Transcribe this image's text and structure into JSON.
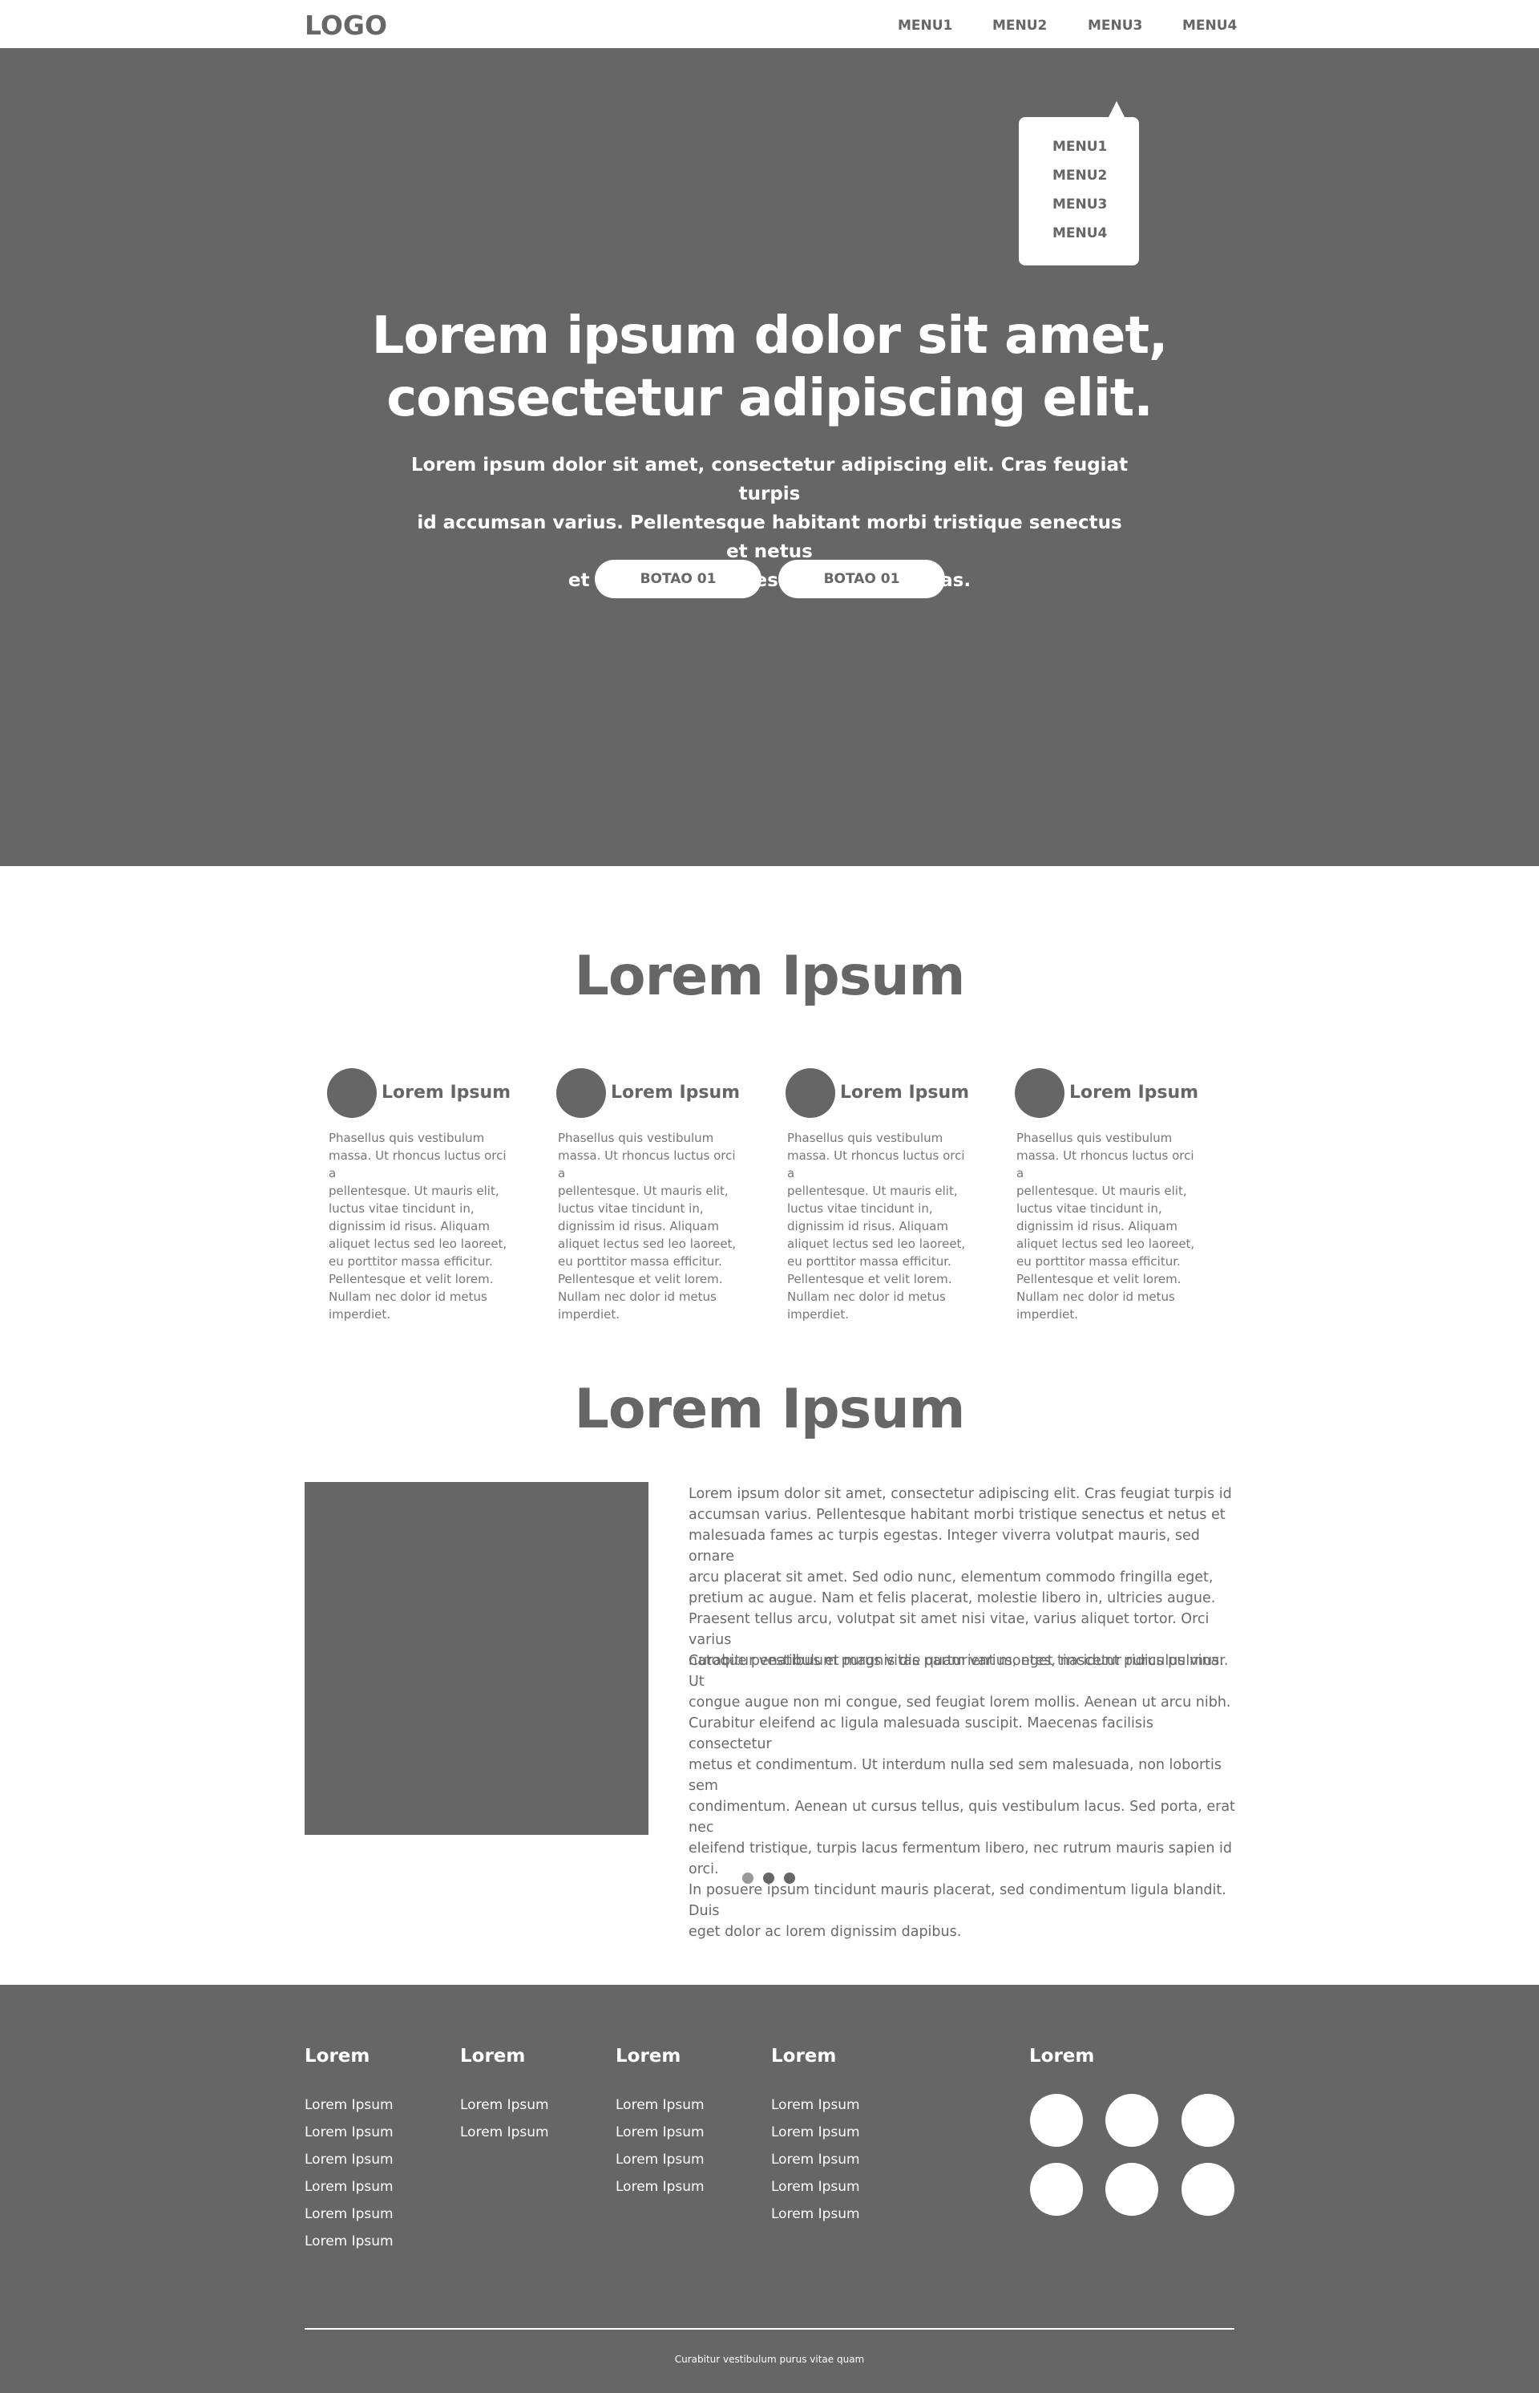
{
  "header": {
    "logo": "LOGO",
    "nav": [
      "MENU1",
      "MENU2",
      "MENU3",
      "MENU4"
    ]
  },
  "dropdown": {
    "items": [
      "MENU1",
      "MENU2",
      "MENU3",
      "MENU4"
    ]
  },
  "hero": {
    "title_line1": "Lorem ipsum dolor sit amet,",
    "title_line2": "consectetur adipiscing elit.",
    "subtitle_line1": "Lorem ipsum dolor sit amet, consectetur adipiscing elit. Cras feugiat turpis",
    "subtitle_line2": "id accumsan varius. Pellentesque habitant morbi tristique senectus et netus",
    "subtitle_line3": "et malesuada fames ac turpis egestas.",
    "buttons": [
      "BOTAO 01",
      "BOTAO 01"
    ]
  },
  "features": {
    "title": "Lorem Ipsum",
    "items": [
      {
        "title": "Lorem Ipsum",
        "lines": [
          "Phasellus quis vestibulum",
          "massa. Ut rhoncus luctus orci a",
          "pellentesque. Ut mauris elit,",
          "luctus vitae tincidunt in,",
          "dignissim id risus. Aliquam",
          "aliquet lectus sed leo laoreet,",
          "eu porttitor massa efficitur.",
          "Pellentesque et velit lorem.",
          "Nullam nec dolor id metus",
          "imperdiet."
        ]
      },
      {
        "title": "Lorem Ipsum",
        "lines": [
          "Phasellus quis vestibulum",
          "massa. Ut rhoncus luctus orci a",
          "pellentesque. Ut mauris elit,",
          "luctus vitae tincidunt in,",
          "dignissim id risus. Aliquam",
          "aliquet lectus sed leo laoreet,",
          "eu porttitor massa efficitur.",
          "Pellentesque et velit lorem.",
          "Nullam nec dolor id metus",
          "imperdiet."
        ]
      },
      {
        "title": "Lorem Ipsum",
        "lines": [
          "Phasellus quis vestibulum",
          "massa. Ut rhoncus luctus orci a",
          "pellentesque. Ut mauris elit,",
          "luctus vitae tincidunt in,",
          "dignissim id risus. Aliquam",
          "aliquet lectus sed leo laoreet,",
          "eu porttitor massa efficitur.",
          "Pellentesque et velit lorem.",
          "Nullam nec dolor id metus",
          "imperdiet."
        ]
      },
      {
        "title": "Lorem Ipsum",
        "lines": [
          "Phasellus quis vestibulum",
          "massa. Ut rhoncus luctus orci a",
          "pellentesque. Ut mauris elit,",
          "luctus vitae tincidunt in,",
          "dignissim id risus. Aliquam",
          "aliquet lectus sed leo laoreet,",
          "eu porttitor massa efficitur.",
          "Pellentesque et velit lorem.",
          "Nullam nec dolor id metus",
          "imperdiet."
        ]
      }
    ]
  },
  "showcase": {
    "title": "Lorem Ipsum",
    "paragraph1": [
      "Lorem ipsum dolor sit amet, consectetur adipiscing elit. Cras feugiat turpis id",
      "accumsan varius. Pellentesque habitant morbi tristique senectus et netus et",
      "malesuada fames ac turpis egestas. Integer viverra volutpat mauris, sed ornare",
      "arcu placerat sit amet. Sed odio nunc, elementum commodo fringilla eget,",
      "pretium ac augue. Nam et felis placerat, molestie libero in, ultricies augue.",
      "Praesent tellus arcu, volutpat sit amet nisi vitae, varius aliquet tortor. Orci varius",
      "natoque penatibus et magnis dis parturient montes, nascetur ridiculus mus."
    ],
    "paragraph2": [
      "Curabitur vestibulum purus vitae quam varius, eget tincidunt purus pulvinar. Ut",
      "congue augue non mi congue, sed feugiat lorem mollis. Aenean ut arcu nibh.",
      "Curabitur eleifend ac ligula malesuada suscipit. Maecenas facilisis consectetur",
      "metus et condimentum. Ut interdum nulla sed sem malesuada, non lobortis sem",
      "condimentum. Aenean ut cursus tellus, quis vestibulum lacus. Sed porta, erat nec",
      "eleifend tristique, turpis lacus fermentum libero, nec rutrum mauris sapien id orci.",
      "In posuere ipsum tincidunt mauris placerat, sed condimentum ligula blandit. Duis",
      "eget dolor ac lorem dignissim dapibus."
    ],
    "active_slide": 1,
    "slide_count": 3
  },
  "footer": {
    "columns": [
      {
        "title": "Lorem",
        "links": [
          "Lorem Ipsum",
          "Lorem Ipsum",
          "Lorem Ipsum",
          "Lorem Ipsum",
          "Lorem Ipsum",
          "Lorem Ipsum"
        ]
      },
      {
        "title": "Lorem",
        "links": [
          "Lorem Ipsum",
          "Lorem Ipsum"
        ]
      },
      {
        "title": "Lorem",
        "links": [
          "Lorem Ipsum",
          "Lorem Ipsum",
          "Lorem Ipsum",
          "Lorem Ipsum"
        ]
      },
      {
        "title": "Lorem",
        "links": [
          "Lorem Ipsum",
          "Lorem Ipsum",
          "Lorem Ipsum",
          "Lorem Ipsum",
          "Lorem Ipsum"
        ]
      }
    ],
    "social_title": "Lorem",
    "social_icons": [
      "social-icon",
      "social-icon",
      "social-icon",
      "social-icon",
      "social-icon",
      "social-icon"
    ],
    "copyright": "Curabitur vestibulum purus vitae quam"
  },
  "colors": {
    "primary_gray": "#666666",
    "background": "#ffffff",
    "text_light": "#ffffff"
  }
}
